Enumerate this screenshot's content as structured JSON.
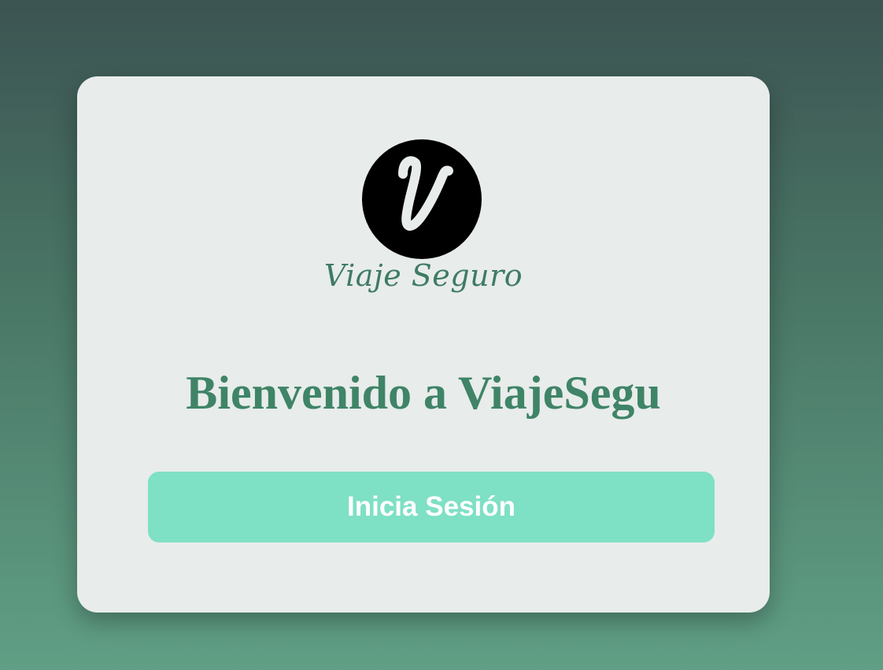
{
  "logo": {
    "letter": "V",
    "brand_text": "Viaje Seguro",
    "icon": "v-letter-logo-icon"
  },
  "welcome": {
    "title": "Bienvenido a ViajeSegu"
  },
  "actions": {
    "login_label": "Inicia Sesión"
  },
  "colors": {
    "background_top": "#3c5452",
    "background_bottom": "#609f85",
    "card": "#e8eceb",
    "brand_green": "#3f8467",
    "button": "#7ee0c5",
    "button_text": "#ffffff"
  }
}
